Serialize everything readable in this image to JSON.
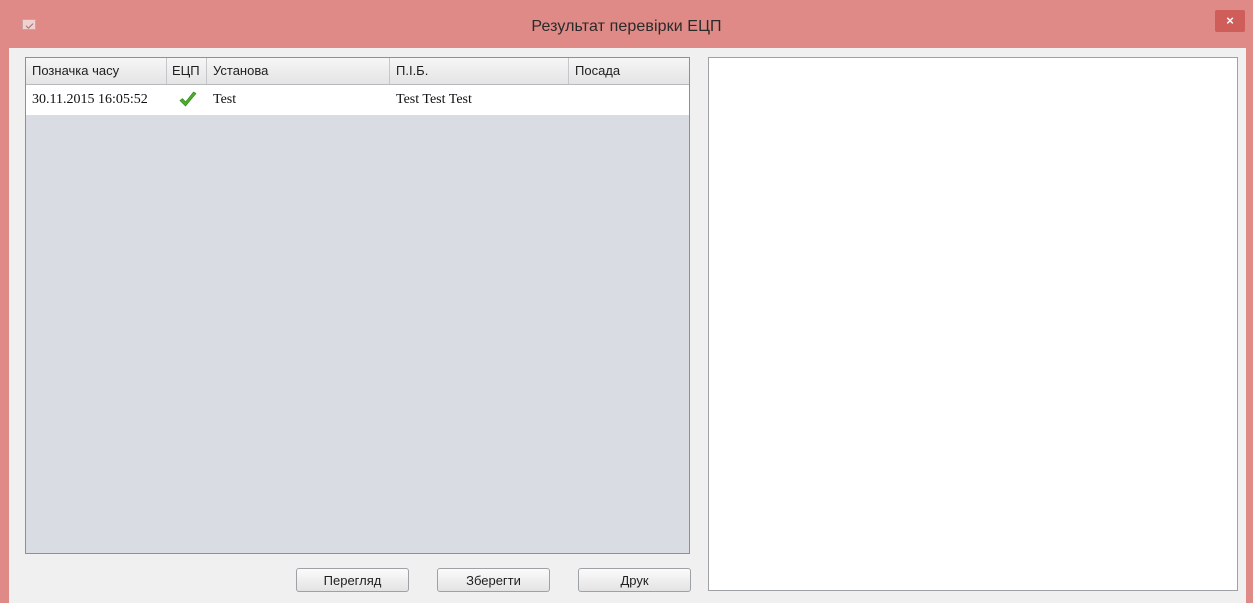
{
  "window": {
    "title": "Результат перевірки ЕЦП",
    "close_symbol": "×"
  },
  "table": {
    "columns": [
      "Позначка часу",
      "ЕЦП",
      "Установа",
      "П.І.Б.",
      "Посада"
    ],
    "rows": [
      {
        "timestamp": "30.11.2015 16:05:52",
        "signature_icon": "green-check-icon",
        "institution": "Test",
        "full_name": "Test Test Test",
        "position": ""
      }
    ]
  },
  "buttons": {
    "view": "Перегляд",
    "save": "Зберегти",
    "print": "Друк"
  },
  "colors": {
    "titlebar": "#df8a87",
    "close_button": "#cf5d59",
    "check": "#4caf2a"
  }
}
